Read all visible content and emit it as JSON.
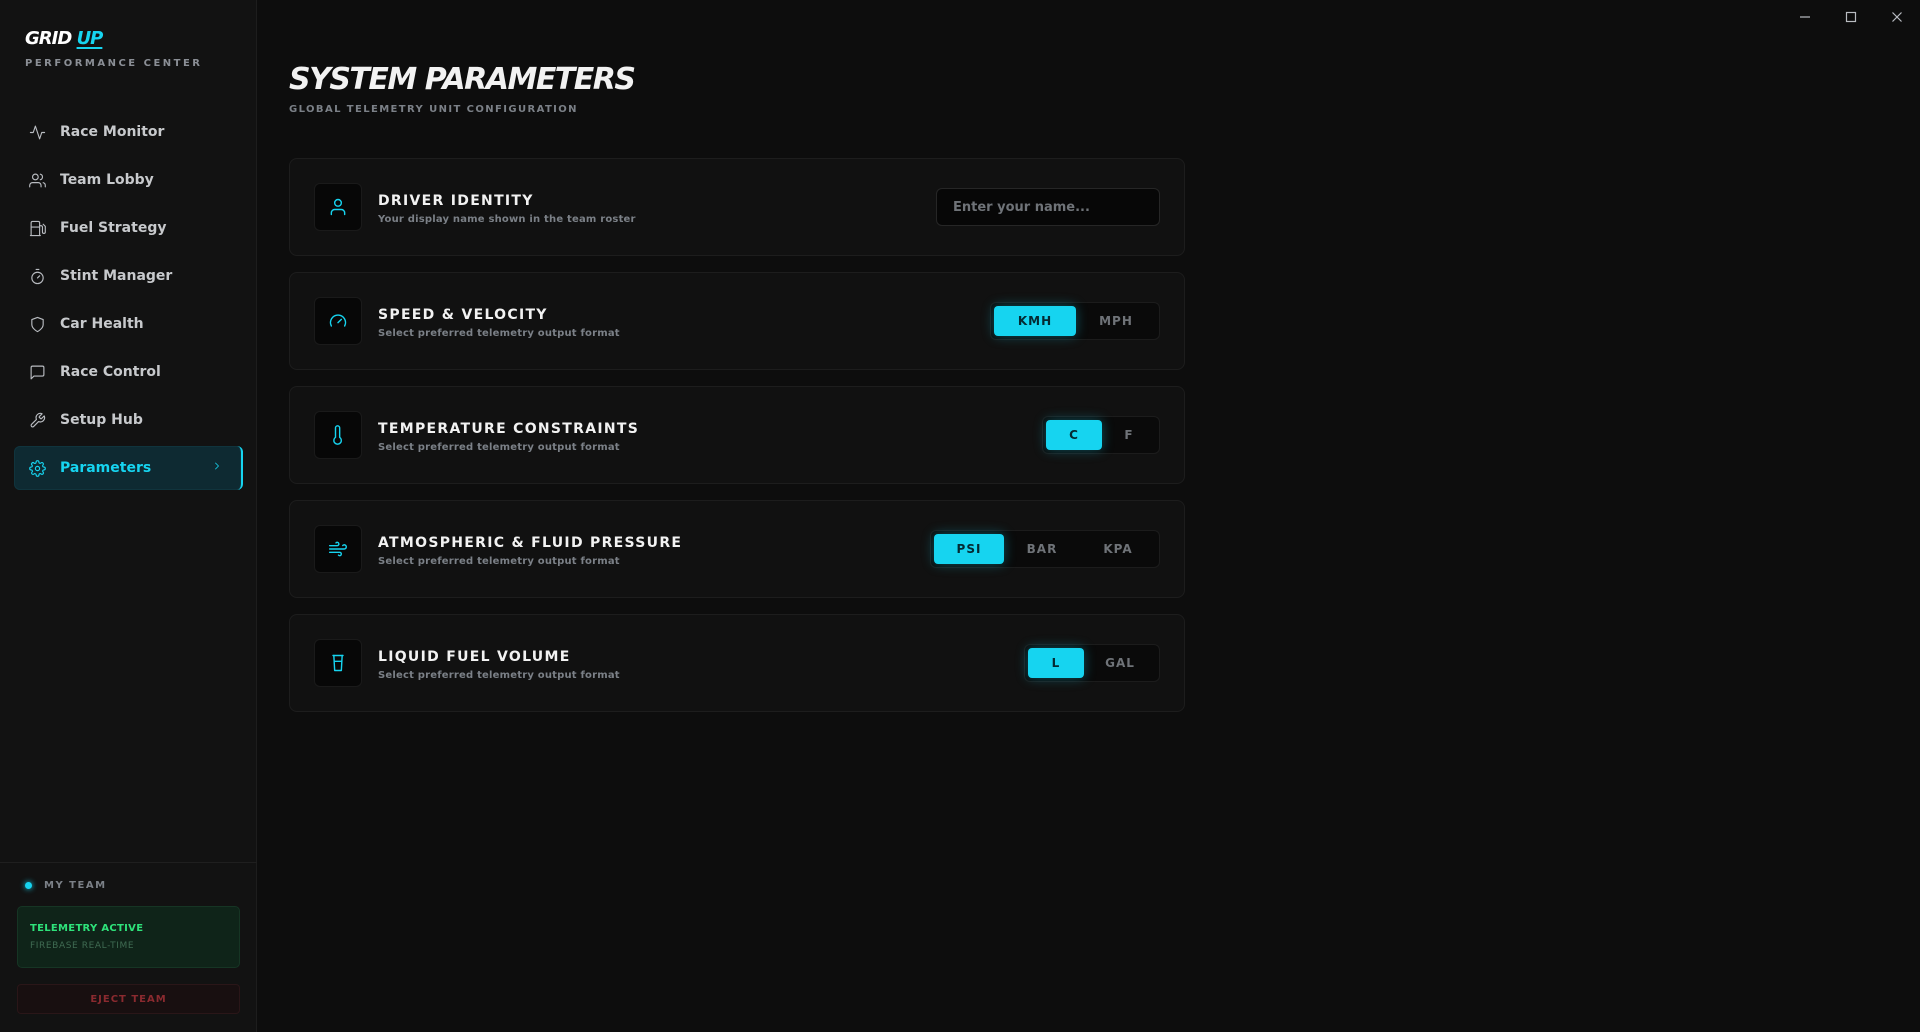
{
  "brand": {
    "name": "GRID",
    "name_accent": "UP",
    "subtitle": "PERFORMANCE CENTER"
  },
  "sidebar": {
    "items": [
      {
        "label": "Race Monitor",
        "icon": "activity-icon"
      },
      {
        "label": "Team Lobby",
        "icon": "users-icon"
      },
      {
        "label": "Fuel Strategy",
        "icon": "fuel-icon"
      },
      {
        "label": "Stint Manager",
        "icon": "stopwatch-icon"
      },
      {
        "label": "Car Health",
        "icon": "shield-icon"
      },
      {
        "label": "Race Control",
        "icon": "message-square-icon"
      },
      {
        "label": "Setup Hub",
        "icon": "wrench-icon"
      },
      {
        "label": "Parameters",
        "icon": "gear-icon",
        "active": true
      }
    ],
    "team_label": "MY TEAM",
    "telemetry_status": "TELEMETRY ACTIVE",
    "telemetry_source": "FIREBASE REAL-TIME",
    "eject_label": "EJECT TEAM"
  },
  "page": {
    "title": "SYSTEM PARAMETERS",
    "subtitle": "GLOBAL TELEMETRY UNIT CONFIGURATION"
  },
  "settings": {
    "driver": {
      "title": "DRIVER IDENTITY",
      "description": "Your display name shown in the team roster",
      "placeholder": "Enter your name...",
      "value": ""
    },
    "speed": {
      "title": "SPEED & VELOCITY",
      "description": "Select preferred telemetry output format",
      "options": [
        "KMH",
        "MPH"
      ],
      "selected": "KMH"
    },
    "temperature": {
      "title": "TEMPERATURE CONSTRAINTS",
      "description": "Select preferred telemetry output format",
      "options": [
        "C",
        "F"
      ],
      "selected": "C"
    },
    "pressure": {
      "title": "ATMOSPHERIC & FLUID PRESSURE",
      "description": "Select preferred telemetry output format",
      "options": [
        "PSI",
        "BAR",
        "KPA"
      ],
      "selected": "PSI"
    },
    "fuel": {
      "title": "LIQUID FUEL VOLUME",
      "description": "Select preferred telemetry output format",
      "options": [
        "L",
        "GAL"
      ],
      "selected": "L"
    }
  },
  "colors": {
    "accent": "#16d4f0",
    "background": "#0d0d0d",
    "telemetry_green": "#2ee27a",
    "danger": "#8a2a2f"
  }
}
